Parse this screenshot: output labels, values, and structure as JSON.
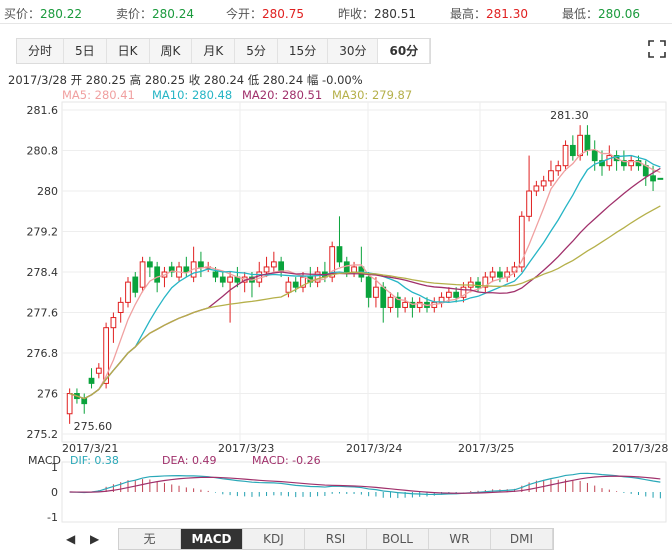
{
  "quote_bar": {
    "bid_label": "买价：",
    "bid_value": "280.22",
    "ask_label": "卖价：",
    "ask_value": "280.24",
    "open_label": "今开：",
    "open_value": "280.75",
    "prev_close_label": "昨收：",
    "prev_close_value": "280.51",
    "high_label": "最高：",
    "high_value": "281.30",
    "low_label": "最低：",
    "low_value": "280.06"
  },
  "period_tabs": [
    "分时",
    "5日",
    "日K",
    "周K",
    "月K",
    "5分",
    "15分",
    "30分",
    "60分"
  ],
  "active_period": "60分",
  "info": "2017/3/28 开 280.25 高 280.25 收 280.24 低 280.24 幅 -0.00%",
  "ma": {
    "ma5": "MA5: 280.41",
    "ma10": "MA10: 280.48",
    "ma20": "MA20: 280.51",
    "ma30": "MA30: 279.87"
  },
  "colors": {
    "up": "#e02020",
    "down": "#0aa33c",
    "ma5": "#f0a0a0",
    "ma10": "#26b5c5",
    "ma20": "#a0306b",
    "ma30": "#b5b04a",
    "dif": "#2aa8b8",
    "dea": "#a0306b",
    "macd_pos": "#c04050",
    "macd_neg": "#20a0b0"
  },
  "chart_data": {
    "type": "candlestick",
    "y_ticks": [
      "281.6",
      "280.8",
      "280",
      "279.2",
      "278.4",
      "277.6",
      "276.8",
      "276",
      "275.2"
    ],
    "ylim": [
      275.2,
      281.6
    ],
    "x_labels": [
      "2017/3/21",
      "2017/3/23",
      "2017/3/24",
      "2017/3/25",
      "2017/3/28"
    ],
    "high_annotation": "281.30",
    "low_annotation": "275.60",
    "candles": [
      [
        275.6,
        276.0,
        275.4,
        276.1
      ],
      [
        276.0,
        275.9,
        275.8,
        276.1
      ],
      [
        275.9,
        275.8,
        275.6,
        276.0
      ],
      [
        276.3,
        276.2,
        276.1,
        276.5
      ],
      [
        276.4,
        276.5,
        276.3,
        276.6
      ],
      [
        276.2,
        277.3,
        276.1,
        277.4
      ],
      [
        277.3,
        277.5,
        277.0,
        277.6
      ],
      [
        277.6,
        277.8,
        277.4,
        277.9
      ],
      [
        277.8,
        278.2,
        277.7,
        278.3
      ],
      [
        278.3,
        278.0,
        277.9,
        278.4
      ],
      [
        278.1,
        278.6,
        278.0,
        278.7
      ],
      [
        278.6,
        278.5,
        278.3,
        278.7
      ],
      [
        278.5,
        278.2,
        278.0,
        278.6
      ],
      [
        278.3,
        278.4,
        278.1,
        278.5
      ],
      [
        278.5,
        278.4,
        278.3,
        278.6
      ],
      [
        278.3,
        278.5,
        278.2,
        278.6
      ],
      [
        278.5,
        278.4,
        278.3,
        278.7
      ],
      [
        278.3,
        278.6,
        278.2,
        278.9
      ],
      [
        278.6,
        278.5,
        278.3,
        278.8
      ],
      [
        278.5,
        278.5,
        278.4,
        278.6
      ],
      [
        278.4,
        278.3,
        278.2,
        278.5
      ],
      [
        278.3,
        278.2,
        278.1,
        278.4
      ],
      [
        278.2,
        278.3,
        277.4,
        278.4
      ],
      [
        278.3,
        278.2,
        278.1,
        278.5
      ],
      [
        278.2,
        278.3,
        278.0,
        278.4
      ],
      [
        278.3,
        278.2,
        277.9,
        278.4
      ],
      [
        278.2,
        278.4,
        278.1,
        278.6
      ],
      [
        278.4,
        278.5,
        278.3,
        278.7
      ],
      [
        278.5,
        278.6,
        278.4,
        278.8
      ],
      [
        278.6,
        278.4,
        278.3,
        278.7
      ],
      [
        278.0,
        278.2,
        277.9,
        278.3
      ],
      [
        278.2,
        278.1,
        278.0,
        278.3
      ],
      [
        278.1,
        278.3,
        278.0,
        278.4
      ],
      [
        278.3,
        278.2,
        278.1,
        278.5
      ],
      [
        278.2,
        278.4,
        278.1,
        278.5
      ],
      [
        278.4,
        278.3,
        278.2,
        278.6
      ],
      [
        278.3,
        278.9,
        278.2,
        279.0
      ],
      [
        278.9,
        278.6,
        278.5,
        279.5
      ],
      [
        278.6,
        278.4,
        278.3,
        278.7
      ],
      [
        278.4,
        278.5,
        278.3,
        278.6
      ],
      [
        278.5,
        278.3,
        278.2,
        278.9
      ],
      [
        278.3,
        277.9,
        277.7,
        278.4
      ],
      [
        277.9,
        278.1,
        277.7,
        278.3
      ],
      [
        278.1,
        277.7,
        277.4,
        278.2
      ],
      [
        277.7,
        277.9,
        277.6,
        278.0
      ],
      [
        277.9,
        277.7,
        277.5,
        278.0
      ],
      [
        277.7,
        277.8,
        277.6,
        277.9
      ],
      [
        277.8,
        277.7,
        277.5,
        277.9
      ],
      [
        277.7,
        277.8,
        277.6,
        277.9
      ],
      [
        277.8,
        277.7,
        277.6,
        277.9
      ],
      [
        277.7,
        277.8,
        277.6,
        277.9
      ],
      [
        277.8,
        277.9,
        277.7,
        278.0
      ],
      [
        277.9,
        278.0,
        277.8,
        278.1
      ],
      [
        278.0,
        277.9,
        277.8,
        278.1
      ],
      [
        277.9,
        278.1,
        277.8,
        278.2
      ],
      [
        278.1,
        278.2,
        278.0,
        278.3
      ],
      [
        278.2,
        278.1,
        278.0,
        278.3
      ],
      [
        278.1,
        278.3,
        278.0,
        278.4
      ],
      [
        278.3,
        278.4,
        278.2,
        278.5
      ],
      [
        278.4,
        278.3,
        278.2,
        278.5
      ],
      [
        278.3,
        278.4,
        278.2,
        278.5
      ],
      [
        278.4,
        278.5,
        278.3,
        278.6
      ],
      [
        278.5,
        279.5,
        278.4,
        279.6
      ],
      [
        279.5,
        280.0,
        279.4,
        280.7
      ],
      [
        280.0,
        280.1,
        279.9,
        280.2
      ],
      [
        280.1,
        280.2,
        280.0,
        280.3
      ],
      [
        280.2,
        280.4,
        280.1,
        280.6
      ],
      [
        280.4,
        280.5,
        280.3,
        280.6
      ],
      [
        280.5,
        280.9,
        280.4,
        281.0
      ],
      [
        280.9,
        280.7,
        280.6,
        281.1
      ],
      [
        280.7,
        281.1,
        280.6,
        281.3
      ],
      [
        281.1,
        280.8,
        280.7,
        281.3
      ],
      [
        280.8,
        280.6,
        280.4,
        281.0
      ],
      [
        280.6,
        280.5,
        280.3,
        280.8
      ],
      [
        280.5,
        280.7,
        280.4,
        280.9
      ],
      [
        280.7,
        280.6,
        280.4,
        280.8
      ],
      [
        280.6,
        280.5,
        280.4,
        280.8
      ],
      [
        280.5,
        280.6,
        280.4,
        280.7
      ],
      [
        280.6,
        280.5,
        280.4,
        280.7
      ],
      [
        280.5,
        280.3,
        280.1,
        280.6
      ],
      [
        280.3,
        280.2,
        280.0,
        280.5
      ],
      [
        280.25,
        280.24,
        280.24,
        280.25
      ]
    ],
    "macd": {
      "labels": {
        "title": "MACD",
        "dif": "DIF: 0.38",
        "dea": "DEA: 0.49",
        "macd": "MACD: -0.26"
      },
      "y_ticks": [
        "1",
        "0",
        "-1"
      ],
      "ylim": [
        -1.2,
        1.2
      ]
    }
  },
  "indicator_tabs": [
    "无",
    "MACD",
    "KDJ",
    "RSI",
    "BOLL",
    "WR",
    "DMI"
  ],
  "active_indicator": "MACD",
  "nav": {
    "prev": "◀",
    "next": "▶"
  }
}
